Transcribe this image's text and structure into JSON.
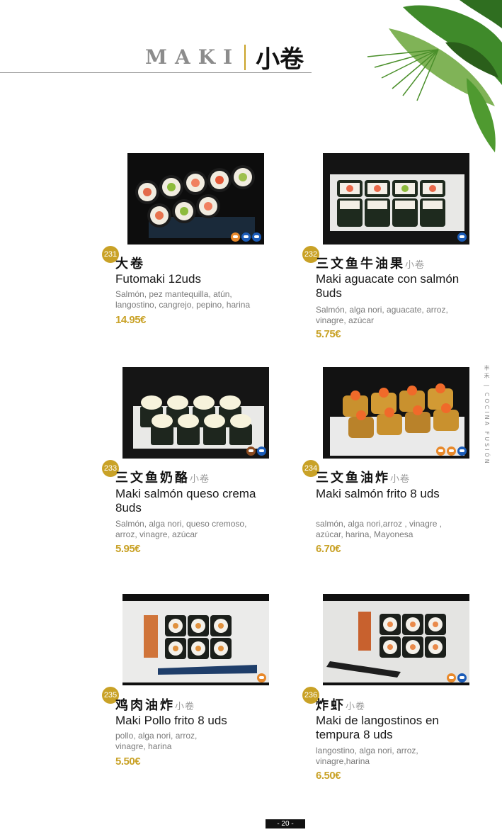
{
  "header": {
    "title_latin": "MAKI",
    "title_cn": "小卷"
  },
  "side_brand": "丰禾 | COCINA FUSIÓN",
  "page_number": "- 20 -",
  "colors": {
    "accent": "#c9a227",
    "icon_blue": "#1b5cb8",
    "icon_orange": "#e8892b",
    "icon_brown": "#8a4a20"
  },
  "items": [
    {
      "num": "231",
      "cn": "大卷",
      "cn_small": "",
      "name": "Futomaki 12uds",
      "desc": "Salmón, pez mantequilla, atún, langostino, cangrejo, pepino, harina",
      "price": "14.95€",
      "icons": [
        "orange-icon",
        "fish-icon",
        "crab-icon"
      ]
    },
    {
      "num": "232",
      "cn": "三文鱼牛油果",
      "cn_small": "小卷",
      "name": "Maki aguacate con salmón 8uds",
      "desc": "Salmón, alga nori, aguacate, arroz, vinagre, azúcar",
      "price": "5.75€",
      "icons": [
        "fish-icon"
      ]
    },
    {
      "num": "233",
      "cn": "三文鱼奶酪",
      "cn_small": "小卷",
      "name": "Maki salmón queso crema 8uds",
      "desc": "Salmón, alga nori, queso cremoso, arroz, vinagre, azúcar",
      "price": "5.95€",
      "icons": [
        "milk-icon",
        "fish-icon"
      ]
    },
    {
      "num": "234",
      "cn": "三文鱼油炸",
      "cn_small": "小卷",
      "name": "Maki salmón frito 8 uds",
      "desc": "salmón, alga nori,arroz , vinagre , azúcar, harina, Mayonesa",
      "price": "6.70€",
      "icons": [
        "wheat-icon",
        "egg-icon",
        "fish-icon"
      ]
    },
    {
      "num": "235",
      "cn": "鸡肉油炸",
      "cn_small": "小卷",
      "name": "Maki Pollo frito 8 uds",
      "desc": "pollo, alga nori, arroz, vinagre, harina",
      "price": "5.50€",
      "icons": [
        "wheat-icon"
      ]
    },
    {
      "num": "236",
      "cn": "炸虾",
      "cn_small": "小卷",
      "name": "Maki de langostinos en tempura 8 uds",
      "desc": "langostino, alga nori, arroz, vinagre,harina",
      "price": "6.50€",
      "icons": [
        "wheat-icon",
        "crab-icon"
      ]
    }
  ]
}
